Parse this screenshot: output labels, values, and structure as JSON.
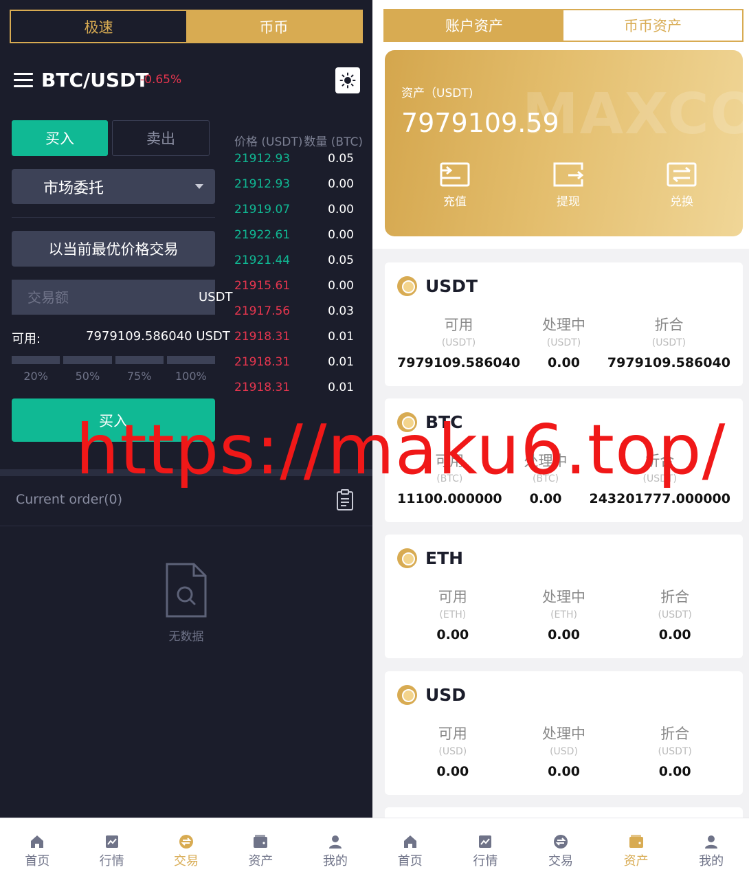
{
  "left": {
    "mode_tabs": [
      {
        "label": "极速"
      },
      {
        "label": "币币"
      }
    ],
    "pair": {
      "name": "BTC/USDT",
      "change": "-0.65%"
    },
    "buy_sell": {
      "buy": "买入",
      "sell": "卖出"
    },
    "order_type": "市场委托",
    "best_price_btn": "以当前最优价格交易",
    "amount": {
      "placeholder": "交易额",
      "unit": "USDT"
    },
    "available": {
      "label": "可用:",
      "value": "7979109.586040 USDT"
    },
    "percent_options": [
      "20%",
      "50%",
      "75%",
      "100%"
    ],
    "submit": "买入",
    "order_book": {
      "header_price": "价格 (USDT)",
      "header_qty": "数量 (BTC)",
      "rows": [
        {
          "price": "21912.93",
          "qty": "0.05",
          "side": "up"
        },
        {
          "price": "21912.93",
          "qty": "0.00",
          "side": "up"
        },
        {
          "price": "21919.07",
          "qty": "0.00",
          "side": "up"
        },
        {
          "price": "21922.61",
          "qty": "0.00",
          "side": "up"
        },
        {
          "price": "21921.44",
          "qty": "0.05",
          "side": "up"
        },
        {
          "price": "21915.61",
          "qty": "0.00",
          "side": "down"
        },
        {
          "price": "21917.56",
          "qty": "0.03",
          "side": "down"
        },
        {
          "price": "21918.31",
          "qty": "0.01",
          "side": "down"
        },
        {
          "price": "21918.31",
          "qty": "0.01",
          "side": "down"
        },
        {
          "price": "21918.31",
          "qty": "0.01",
          "side": "down"
        }
      ]
    },
    "current_order": "Current order(0)",
    "empty_text": "无数据"
  },
  "right": {
    "tabs": [
      {
        "label": "账户资产"
      },
      {
        "label": "币币资产"
      }
    ],
    "card": {
      "label": "资产（USDT)",
      "value": "7979109.59",
      "watermark": "MAXCOR",
      "actions": [
        {
          "label": "充值",
          "icon": "deposit-icon"
        },
        {
          "label": "提现",
          "icon": "withdraw-icon"
        },
        {
          "label": "兑换",
          "icon": "exchange-icon"
        }
      ]
    },
    "coins": [
      {
        "name": "USDT",
        "available_label": "可用",
        "available_unit": "(USDT)",
        "available": "7979109.586040",
        "pending_label": "处理中",
        "pending_unit": "(USDT)",
        "pending": "0.00",
        "convert_label": "折合",
        "convert_unit": "(USDT)",
        "convert": "7979109.586040"
      },
      {
        "name": "BTC",
        "available_label": "可用",
        "available_unit": "(BTC)",
        "available": "11100.000000",
        "pending_label": "处理中",
        "pending_unit": "(BTC)",
        "pending": "0.00",
        "convert_label": "折合",
        "convert_unit": "(USDT)",
        "convert": "243201777.000000"
      },
      {
        "name": "ETH",
        "available_label": "可用",
        "available_unit": "(ETH)",
        "available": "0.00",
        "pending_label": "处理中",
        "pending_unit": "(ETH)",
        "pending": "0.00",
        "convert_label": "折合",
        "convert_unit": "(USDT)",
        "convert": "0.00"
      },
      {
        "name": "USD",
        "available_label": "可用",
        "available_unit": "(USD)",
        "available": "0.00",
        "pending_label": "处理中",
        "pending_unit": "(USD)",
        "pending": "0.00",
        "convert_label": "折合",
        "convert_unit": "(USDT)",
        "convert": "0.00"
      }
    ]
  },
  "nav": {
    "items": [
      {
        "label": "首页",
        "icon": "home-icon"
      },
      {
        "label": "行情",
        "icon": "chart-icon"
      },
      {
        "label": "交易",
        "icon": "trade-icon"
      },
      {
        "label": "资产",
        "icon": "wallet-icon"
      },
      {
        "label": "我的",
        "icon": "user-icon"
      }
    ],
    "left_active": "交易",
    "right_active": "资产"
  },
  "overlay_url": "https://maku6.top/",
  "colors": {
    "gold": "#d8ab52",
    "green": "#10b994",
    "red": "#e8364f",
    "dark_bg": "#1b1d2b"
  }
}
